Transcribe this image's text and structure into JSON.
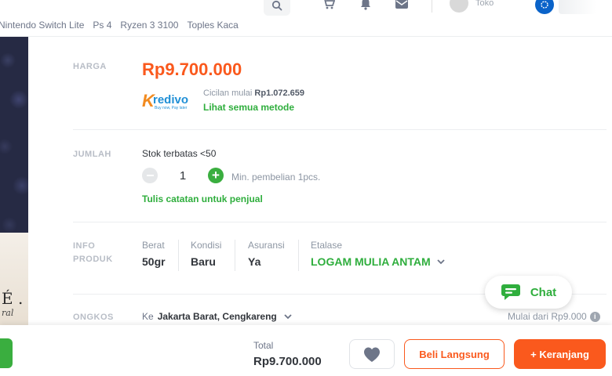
{
  "header": {
    "shop_label": "Toko",
    "keywords": [
      "Nintendo Switch Lite",
      "Ps 4",
      "Ryzen 3 3100",
      "Toples Kaca"
    ]
  },
  "product_image": {
    "text": "É .",
    "subtext": "ral"
  },
  "price_section": {
    "label": "HARGA",
    "price": "Rp9.700.000",
    "kredivo_word": "redivo",
    "kredivo_k": "K",
    "kredivo_tag": "Buy now, Pay later",
    "installment_prefix": "Cicilan mulai ",
    "installment_amount": "Rp1.072.659",
    "see_methods": "Lihat semua metode"
  },
  "quantity_section": {
    "label": "JUMLAH",
    "stock": "Stok terbatas <50",
    "value": "1",
    "min_purchase": "Min. pembelian 1pcs.",
    "seller_note": "Tulis catatan untuk penjual"
  },
  "info_section": {
    "label_line1": "INFO",
    "label_line2": "PRODUK",
    "weight_key": "Berat",
    "weight_val": "50gr",
    "condition_key": "Kondisi",
    "condition_val": "Baru",
    "insurance_key": "Asuransi",
    "insurance_val": "Ya",
    "etalase_key": "Etalase",
    "etalase_val": "LOGAM MULIA ANTAM"
  },
  "shipping_section": {
    "label": "ONGKOS",
    "to_prefix": "Ke",
    "to_location": "Jakarta Barat, Cengkareng",
    "price_from": "Mulai dari Rp9.000"
  },
  "chat": {
    "label": "Chat"
  },
  "bottom_bar": {
    "total_label": "Total",
    "total_value": "Rp9.700.000",
    "buy_now": "Beli Langsung",
    "add_to_cart": "+ Keranjang"
  },
  "colors": {
    "accent_orange": "#fa591d",
    "accent_green": "#2fae3d",
    "text_dark": "#31353b",
    "text_muted": "#8d96a3"
  }
}
